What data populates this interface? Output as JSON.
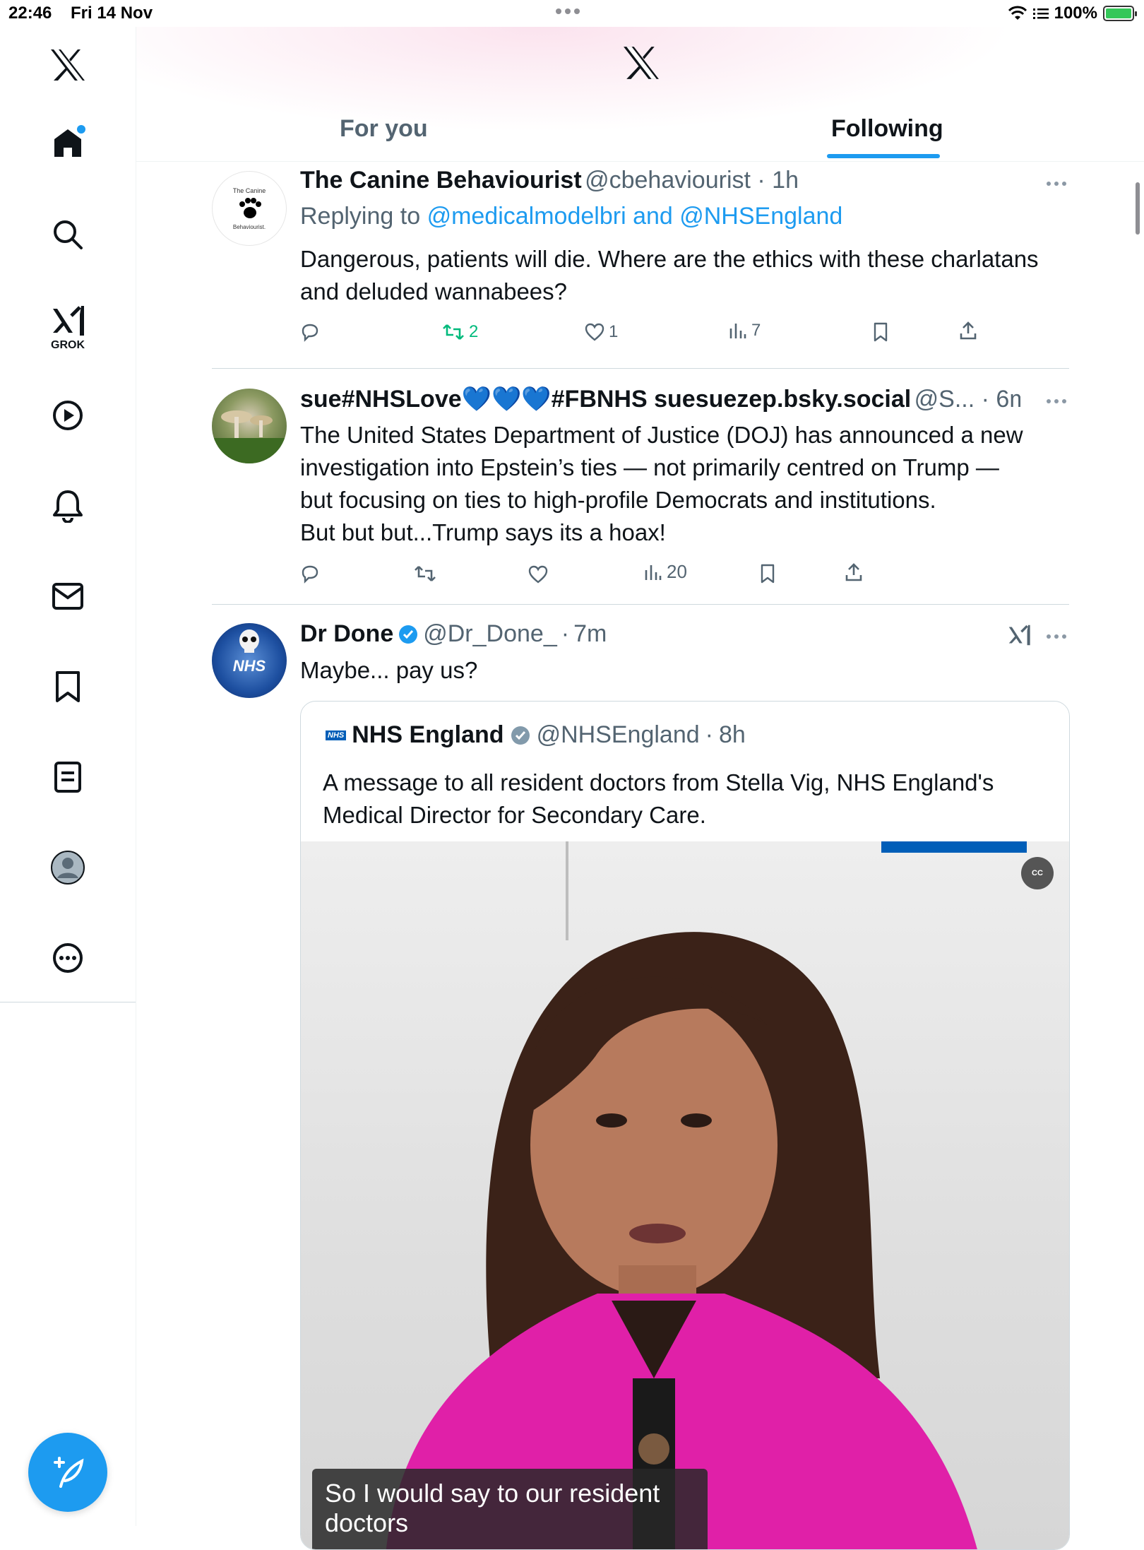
{
  "status_bar": {
    "time": "22:46",
    "date": "Fri 14 Nov",
    "battery": "100%"
  },
  "sidebar": {
    "items": [
      {
        "name": "home",
        "icon": "home-icon"
      },
      {
        "name": "search",
        "icon": "search-icon"
      },
      {
        "name": "grok",
        "icon": "grok-icon",
        "label": "GROK"
      },
      {
        "name": "videos",
        "icon": "play-icon"
      },
      {
        "name": "notifications",
        "icon": "bell-icon"
      },
      {
        "name": "messages",
        "icon": "mail-icon"
      },
      {
        "name": "bookmarks",
        "icon": "bookmark-icon"
      },
      {
        "name": "lists",
        "icon": "list-icon"
      },
      {
        "name": "profile",
        "icon": "profile-icon"
      },
      {
        "name": "more",
        "icon": "more-icon"
      }
    ]
  },
  "header": {
    "tabs": [
      {
        "label": "For you"
      },
      {
        "label": "Following"
      }
    ],
    "active_tab": "Following"
  },
  "colors": {
    "accent": "#1d9bf0",
    "retweet": "#00ba7c"
  },
  "tweets": [
    {
      "name": "The Canine Behaviourist",
      "handle": "@cbehaviourist",
      "time": "1h",
      "avatar_text": [
        "The Canine",
        "Behaviourist."
      ],
      "replying_prefix": "Replying to",
      "replying_to": "@medicalmodelbri and @NHSEngland",
      "text": "Dangerous, patients will die. Where are the ethics with these charlatans and deluded wannabees?",
      "retweets": "2",
      "likes": "1",
      "views": "7"
    },
    {
      "name": "sue#NHSLove💙💙💙#FBNHS suesuezep.bsky.social",
      "handle": "@S...",
      "time": "6m",
      "text_lines": [
        "The United States Department of Justice (DOJ) has announced a new",
        "investigation into Epstein’s ties — not primarily centred on Trump —",
        "but focusing on ties to high-profile Democrats and institutions.",
        "But but but...Trump says its a hoax!"
      ],
      "views": "20"
    },
    {
      "name": "Dr Done",
      "handle": "@Dr_Done_",
      "time": "7m",
      "avatar_text": "NHS",
      "text": "Maybe... pay us?",
      "quote": {
        "logo": "NHS",
        "name": "NHS England",
        "handle": "@NHSEngland",
        "time": "8h",
        "text_lines": [
          "A message to all resident doctors from Stella Vig, NHS England's",
          "Medical Director for Secondary Care."
        ],
        "video_cc": "CC",
        "video_caption": "So I would say to our resident",
        "video_caption_line2": "doctors"
      }
    }
  ]
}
